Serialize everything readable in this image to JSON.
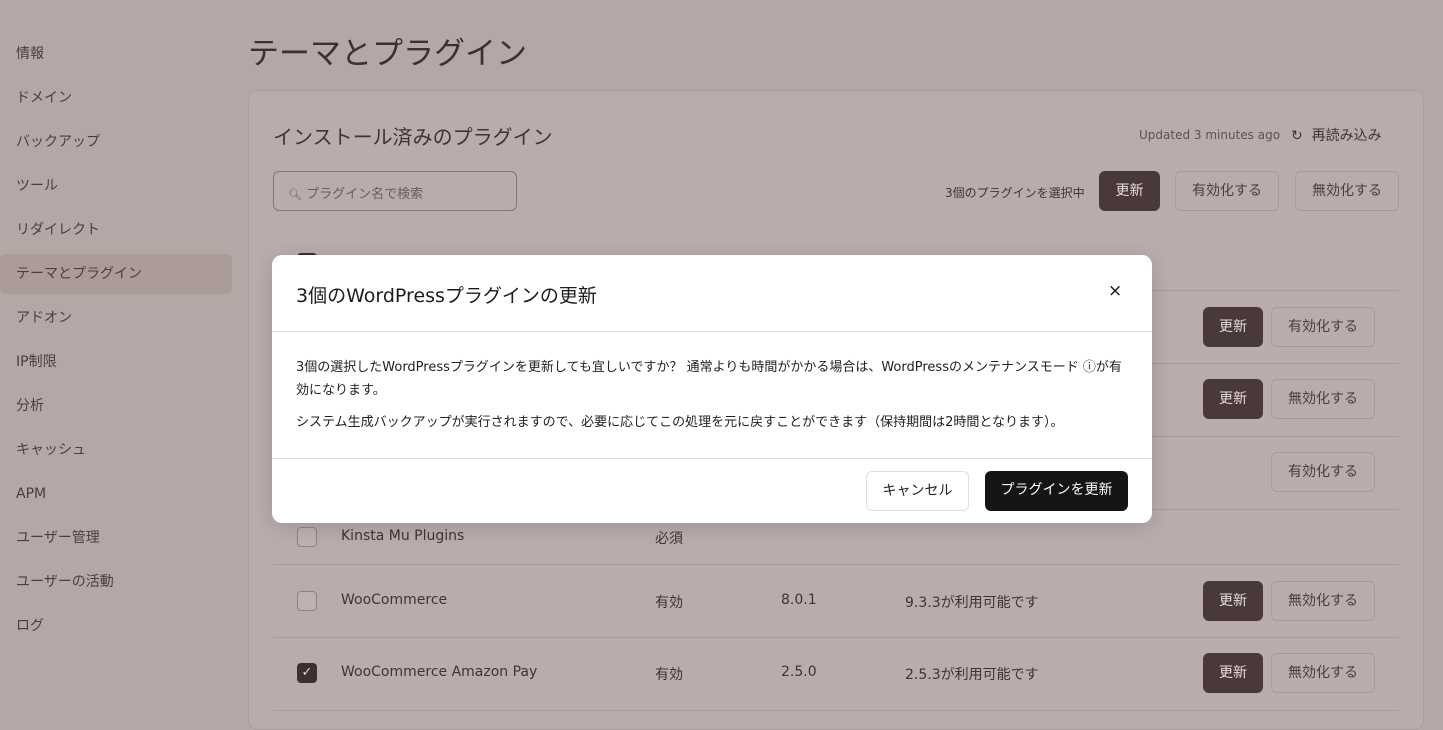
{
  "sidebar": {
    "items": [
      "情報",
      "ドメイン",
      "バックアップ",
      "ツール",
      "リダイレクト",
      "テーマとプラグイン",
      "アドオン",
      "IP制限",
      "分析",
      "キャッシュ",
      "APM",
      "ユーザー管理",
      "ユーザーの活動",
      "ログ"
    ],
    "active": "テーマとプラグイン"
  },
  "page_title": "テーマとプラグイン",
  "card": {
    "title": "インストール済みのプラグイン",
    "updated": "Updated 3 minutes ago",
    "reload": "再読み込み",
    "search_placeholder": "プラグイン名で検索",
    "selected": "3個のプラグインを選択中",
    "bulk_update": "更新",
    "bulk_activate": "有効化する",
    "bulk_deactivate": "無効化する"
  },
  "rows": [
    {
      "name": "",
      "status": "",
      "version": "",
      "update": "",
      "update_btn": "更新",
      "toggle": "有効化する",
      "checked": false
    },
    {
      "name": "",
      "status": "",
      "version": "",
      "update": "",
      "update_btn": "更新",
      "toggle": "無効化する",
      "checked": false
    },
    {
      "name": "",
      "status": "",
      "version": "",
      "update": "",
      "update_btn": "",
      "toggle": "有効化する",
      "checked": false
    },
    {
      "name": "Kinsta Mu Plugins",
      "status": "必須",
      "version": "",
      "update": "",
      "update_btn": "",
      "toggle": "",
      "checked": false
    },
    {
      "name": "WooCommerce",
      "status": "有効",
      "version": "8.0.1",
      "update": "9.3.3が利用可能です",
      "update_btn": "更新",
      "toggle": "無効化する",
      "checked": false
    },
    {
      "name": "WooCommerce Amazon Pay",
      "status": "有効",
      "version": "2.5.0",
      "update": "2.5.3が利用可能です",
      "update_btn": "更新",
      "toggle": "無効化する",
      "checked": true
    }
  ],
  "modal": {
    "title": "3個のWordPressプラグインの更新",
    "close": "×",
    "p1": "3個の選択したWordPressプラグインを更新しても宜しいですか？ 通常よりも時間がかかる場合は、WordPressのメンテナンスモード ⓘが有効になります。",
    "p2": "システム生成バックアップが実行されますので、必要に応じてこの処理を元に戻すことができます（保持期間は2時間となります）。",
    "cancel": "キャンセル",
    "confirm": "プラグインを更新"
  }
}
